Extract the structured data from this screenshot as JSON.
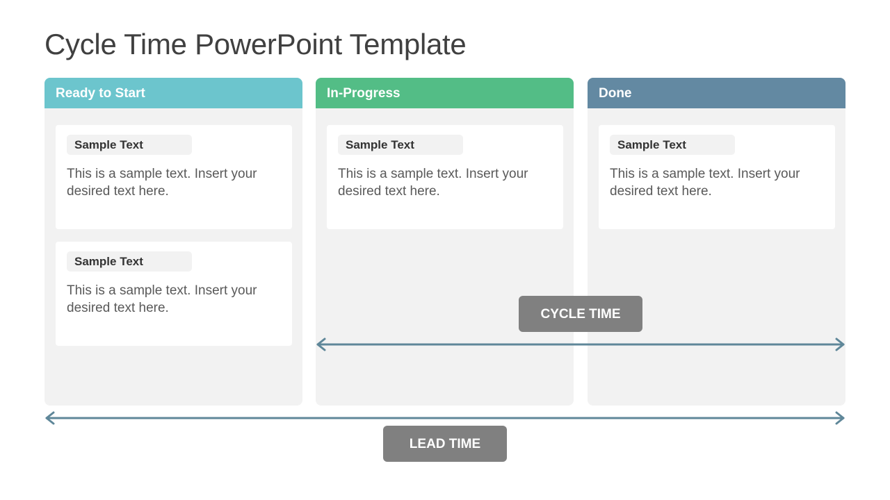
{
  "title": "Cycle Time PowerPoint Template",
  "columns": [
    {
      "label": "Ready to Start",
      "color": "#6cc5cd",
      "cards": [
        {
          "title": "Sample Text",
          "body": "This is a sample text. Insert your desired text here."
        },
        {
          "title": "Sample Text",
          "body": "This is a sample text. Insert your desired text here."
        }
      ]
    },
    {
      "label": "In-Progress",
      "color": "#53bd86",
      "cards": [
        {
          "title": "Sample Text",
          "body": "This is a sample text. Insert your desired text here."
        }
      ]
    },
    {
      "label": "Done",
      "color": "#6389a2",
      "cards": [
        {
          "title": "Sample Text",
          "body": "This is a sample text. Insert your desired text here."
        }
      ]
    }
  ],
  "labels": {
    "cycle_time": "CYCLE TIME",
    "lead_time": "LEAD TIME"
  },
  "colors": {
    "arrow": "#5f8799",
    "pill": "#808080",
    "panel": "#f2f2f2"
  }
}
